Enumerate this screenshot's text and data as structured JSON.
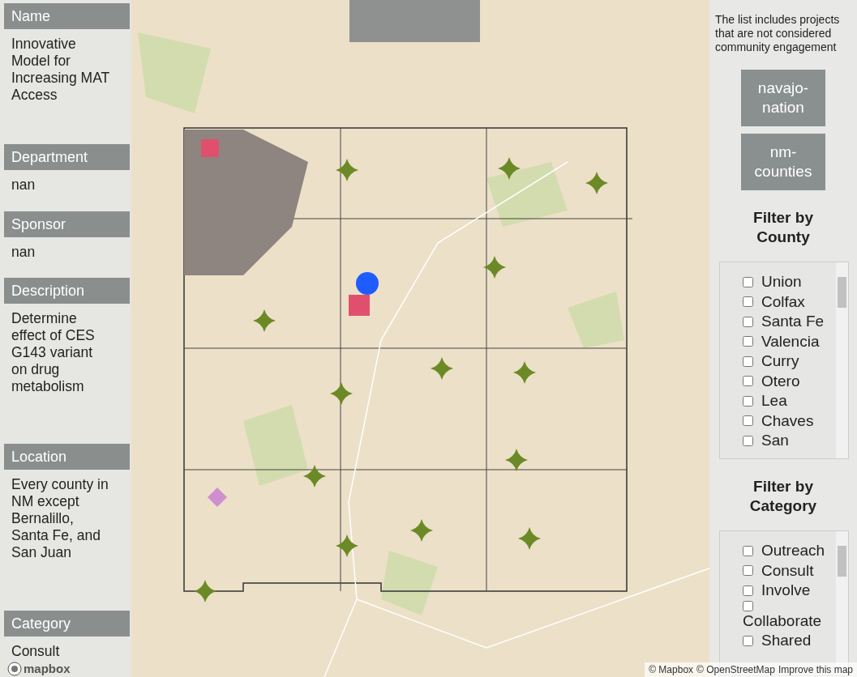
{
  "details": [
    {
      "label": "Name",
      "value": "Innovative Model for Increasing MAT Access"
    },
    {
      "label": "Department",
      "value": "nan"
    },
    {
      "label": "Sponsor",
      "value": "nan"
    },
    {
      "label": "Description",
      "value": "Determine effect of CES G143 variant on drug metabolism"
    },
    {
      "label": "Location",
      "value": "Every county in NM except Bernalillo, Santa Fe, and San Juan"
    },
    {
      "label": "Category",
      "value": "Consult"
    }
  ],
  "map": {
    "kind": "picture",
    "logo": "mapbox",
    "attribution": [
      {
        "text": "© Mapbox"
      },
      {
        "text": "© OpenStreetMap"
      },
      {
        "text": "Improve this map"
      }
    ]
  },
  "note": "The list includes projects that are not considered community engagement",
  "layer_buttons": [
    "navajo-nation",
    "nm-counties"
  ],
  "filters": [
    {
      "title": "Filter by County",
      "items": [
        {
          "label": "Union",
          "checked": false
        },
        {
          "label": "Colfax",
          "checked": false
        },
        {
          "label": "Santa Fe",
          "checked": false
        },
        {
          "label": "Valencia",
          "checked": false
        },
        {
          "label": "Curry",
          "checked": false
        },
        {
          "label": "Otero",
          "checked": false
        },
        {
          "label": "Lea",
          "checked": false
        },
        {
          "label": "Chaves",
          "checked": false
        },
        {
          "label": "San",
          "checked": false
        }
      ]
    },
    {
      "title": "Filter by Category",
      "items": [
        {
          "label": "Outreach",
          "checked": false
        },
        {
          "label": "Consult",
          "checked": false
        },
        {
          "label": "Involve",
          "checked": false
        },
        {
          "label": "Collaborate",
          "checked": false
        },
        {
          "label": "Shared",
          "checked": false
        }
      ]
    }
  ]
}
